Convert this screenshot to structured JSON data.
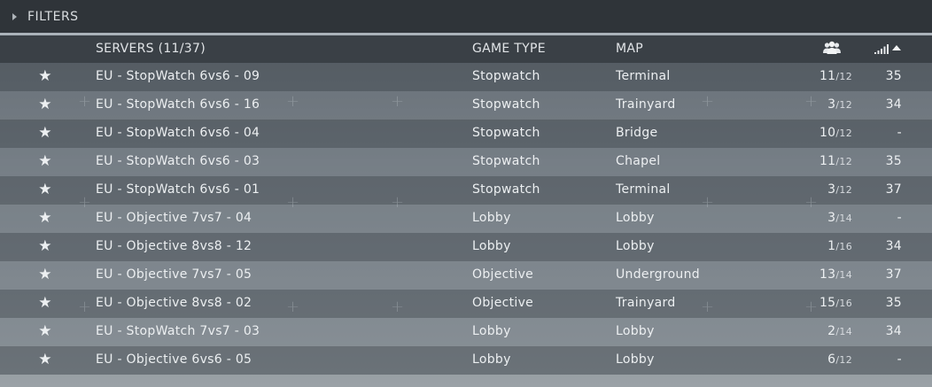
{
  "filters": {
    "label": "FILTERS",
    "icon": "caret-right-icon"
  },
  "header": {
    "servers": "SERVERS (11/37)",
    "game_type": "GAME TYPE",
    "map": "MAP",
    "players_icon": "players-icon",
    "ping_icon": "signal-bars-icon",
    "sort_icon": "sort-ascending-icon"
  },
  "rows": [
    {
      "name": "EU - StopWatch 6vs6 - 09",
      "type": "Stopwatch",
      "map": "Terminal",
      "players": "11",
      "max": "/12",
      "ping": "35"
    },
    {
      "name": "EU - StopWatch 6vs6 - 16",
      "type": "Stopwatch",
      "map": "Trainyard",
      "players": "3",
      "max": "/12",
      "ping": "34"
    },
    {
      "name": "EU - StopWatch 6vs6 - 04",
      "type": "Stopwatch",
      "map": "Bridge",
      "players": "10",
      "max": "/12",
      "ping": "-"
    },
    {
      "name": "EU - StopWatch 6vs6 - 03",
      "type": "Stopwatch",
      "map": "Chapel",
      "players": "11",
      "max": "/12",
      "ping": "35"
    },
    {
      "name": "EU - StopWatch 6vs6 - 01",
      "type": "Stopwatch",
      "map": "Terminal",
      "players": "3",
      "max": "/12",
      "ping": "37"
    },
    {
      "name": "EU - Objective 7vs7 - 04",
      "type": "Lobby",
      "map": "Lobby",
      "players": "3",
      "max": "/14",
      "ping": "-"
    },
    {
      "name": "EU - Objective 8vs8 - 12",
      "type": "Lobby",
      "map": "Lobby",
      "players": "1",
      "max": "/16",
      "ping": "34"
    },
    {
      "name": "EU - Objective 7vs7 - 05",
      "type": "Objective",
      "map": "Underground",
      "players": "13",
      "max": "/14",
      "ping": "37"
    },
    {
      "name": "EU - Objective 8vs8 - 02",
      "type": "Objective",
      "map": "Trainyard",
      "players": "15",
      "max": "/16",
      "ping": "35"
    },
    {
      "name": "EU - StopWatch 7vs7 - 03",
      "type": "Lobby",
      "map": "Lobby",
      "players": "2",
      "max": "/14",
      "ping": "34"
    },
    {
      "name": "EU - Objective 6vs6 - 05",
      "type": "Lobby",
      "map": "Lobby",
      "players": "6",
      "max": "/12",
      "ping": "-"
    }
  ],
  "favorite_icon": "star-icon"
}
